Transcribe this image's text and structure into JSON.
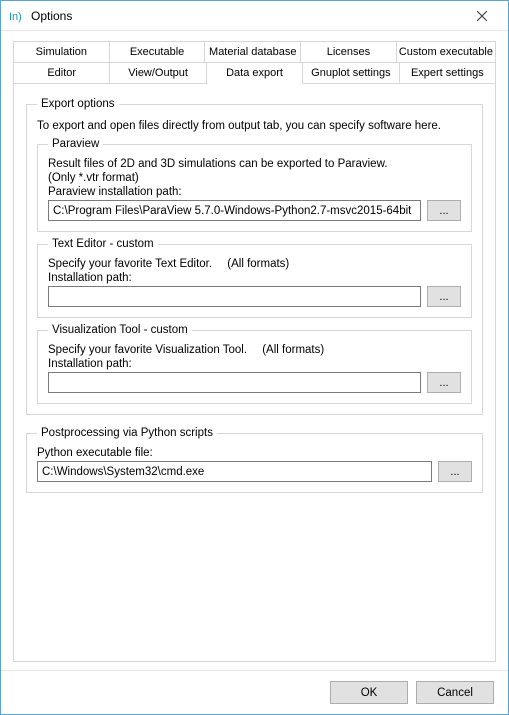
{
  "window": {
    "icon_label": "In)",
    "title": "Options"
  },
  "tabs": {
    "row1": [
      "Simulation",
      "Executable",
      "Material database",
      "Licenses",
      "Custom executable"
    ],
    "row2": [
      "Editor",
      "View/Output",
      "Data export",
      "Gnuplot settings",
      "Expert settings"
    ],
    "active": "Data export"
  },
  "export_options": {
    "legend": "Export options",
    "intro": "To export and open files directly from output tab, you can specify software here.",
    "paraview": {
      "legend": "Paraview",
      "line1": "Result files of 2D and 3D simulations can be exported to Paraview.",
      "line2": "(Only *.vtr format)",
      "path_label": "Paraview installation path:",
      "path_value": "C:\\Program Files\\ParaView 5.7.0-Windows-Python2.7-msvc2015-64bit",
      "browse": "..."
    },
    "text_editor": {
      "legend": "Text Editor - custom",
      "line1": "Specify your favorite Text Editor.",
      "formats": "(All formats)",
      "path_label": "Installation path:",
      "path_value": "",
      "browse": "..."
    },
    "vis_tool": {
      "legend": "Visualization Tool - custom",
      "line1": "Specify your favorite Visualization Tool.",
      "formats": "(All formats)",
      "path_label": "Installation path:",
      "path_value": "",
      "browse": "..."
    }
  },
  "postprocessing": {
    "legend": "Postprocessing via Python scripts",
    "path_label": "Python executable file:",
    "path_value": "C:\\Windows\\System32\\cmd.exe",
    "browse": "..."
  },
  "footer": {
    "ok": "OK",
    "cancel": "Cancel"
  }
}
